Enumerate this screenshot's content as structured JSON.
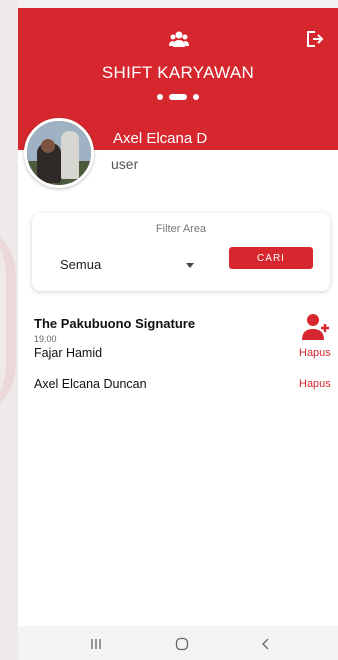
{
  "header": {
    "title": "SHIFT KARYAWAN",
    "group_icon": "group-icon",
    "logout_icon": "logout-icon"
  },
  "user": {
    "name": "Axel Elcana D",
    "role": "user"
  },
  "filter": {
    "label": "Filter Area",
    "selected": "Semua",
    "button_label": "CARI"
  },
  "shift": {
    "name": "The Pakubuono Signature",
    "time": "19.00",
    "employees": [
      {
        "name": "Fajar Hamid",
        "action": "Hapus"
      },
      {
        "name": "Axel Elcana Duncan",
        "action": "Hapus"
      }
    ]
  },
  "colors": {
    "accent": "#d6272e",
    "background": "#ffffff"
  }
}
